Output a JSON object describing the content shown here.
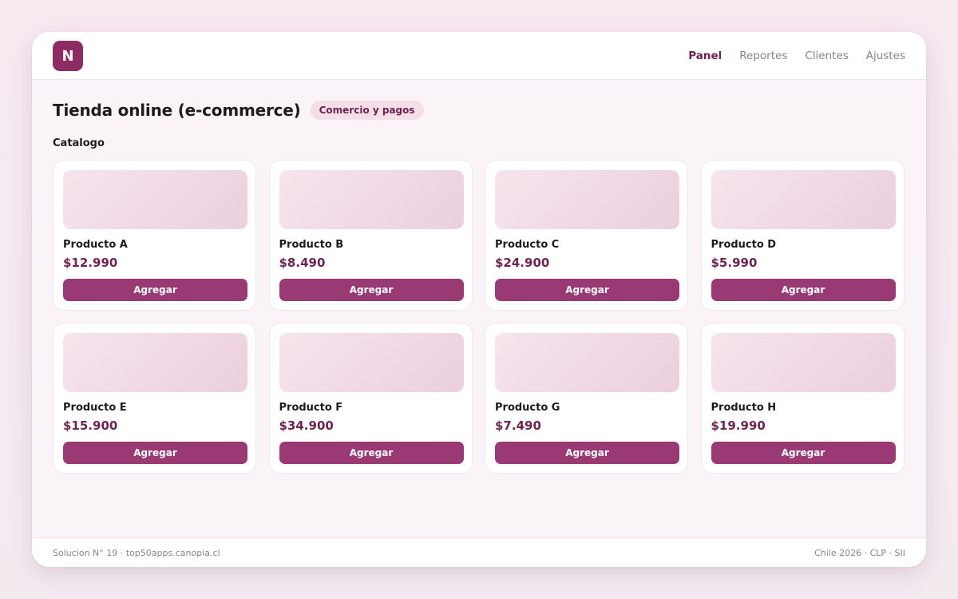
{
  "header": {
    "logo_letter": "N",
    "nav": [
      {
        "label": "Panel",
        "active": true
      },
      {
        "label": "Reportes",
        "active": false
      },
      {
        "label": "Clientes",
        "active": false
      },
      {
        "label": "Ajustes",
        "active": false
      }
    ]
  },
  "main": {
    "title": "Tienda online (e-commerce)",
    "tag": "Comercio y pagos",
    "section_label": "Catalogo",
    "products": [
      {
        "name": "Producto A",
        "price": "$12.990",
        "button": "Agregar"
      },
      {
        "name": "Producto B",
        "price": "$8.490",
        "button": "Agregar"
      },
      {
        "name": "Producto C",
        "price": "$24.900",
        "button": "Agregar"
      },
      {
        "name": "Producto D",
        "price": "$5.990",
        "button": "Agregar"
      },
      {
        "name": "Producto E",
        "price": "$15.900",
        "button": "Agregar"
      },
      {
        "name": "Producto F",
        "price": "$34.900",
        "button": "Agregar"
      },
      {
        "name": "Producto G",
        "price": "$7.490",
        "button": "Agregar"
      },
      {
        "name": "Producto H",
        "price": "$19.990",
        "button": "Agregar"
      }
    ]
  },
  "footer": {
    "left": "Solucion N° 19 · top50apps.canopia.cl",
    "right": "Chile 2026 · CLP · SII"
  },
  "colors": {
    "brand": "#8e2b63",
    "button": "#9a3a74",
    "price": "#6e2450",
    "tag_bg": "#f4dfe9"
  }
}
